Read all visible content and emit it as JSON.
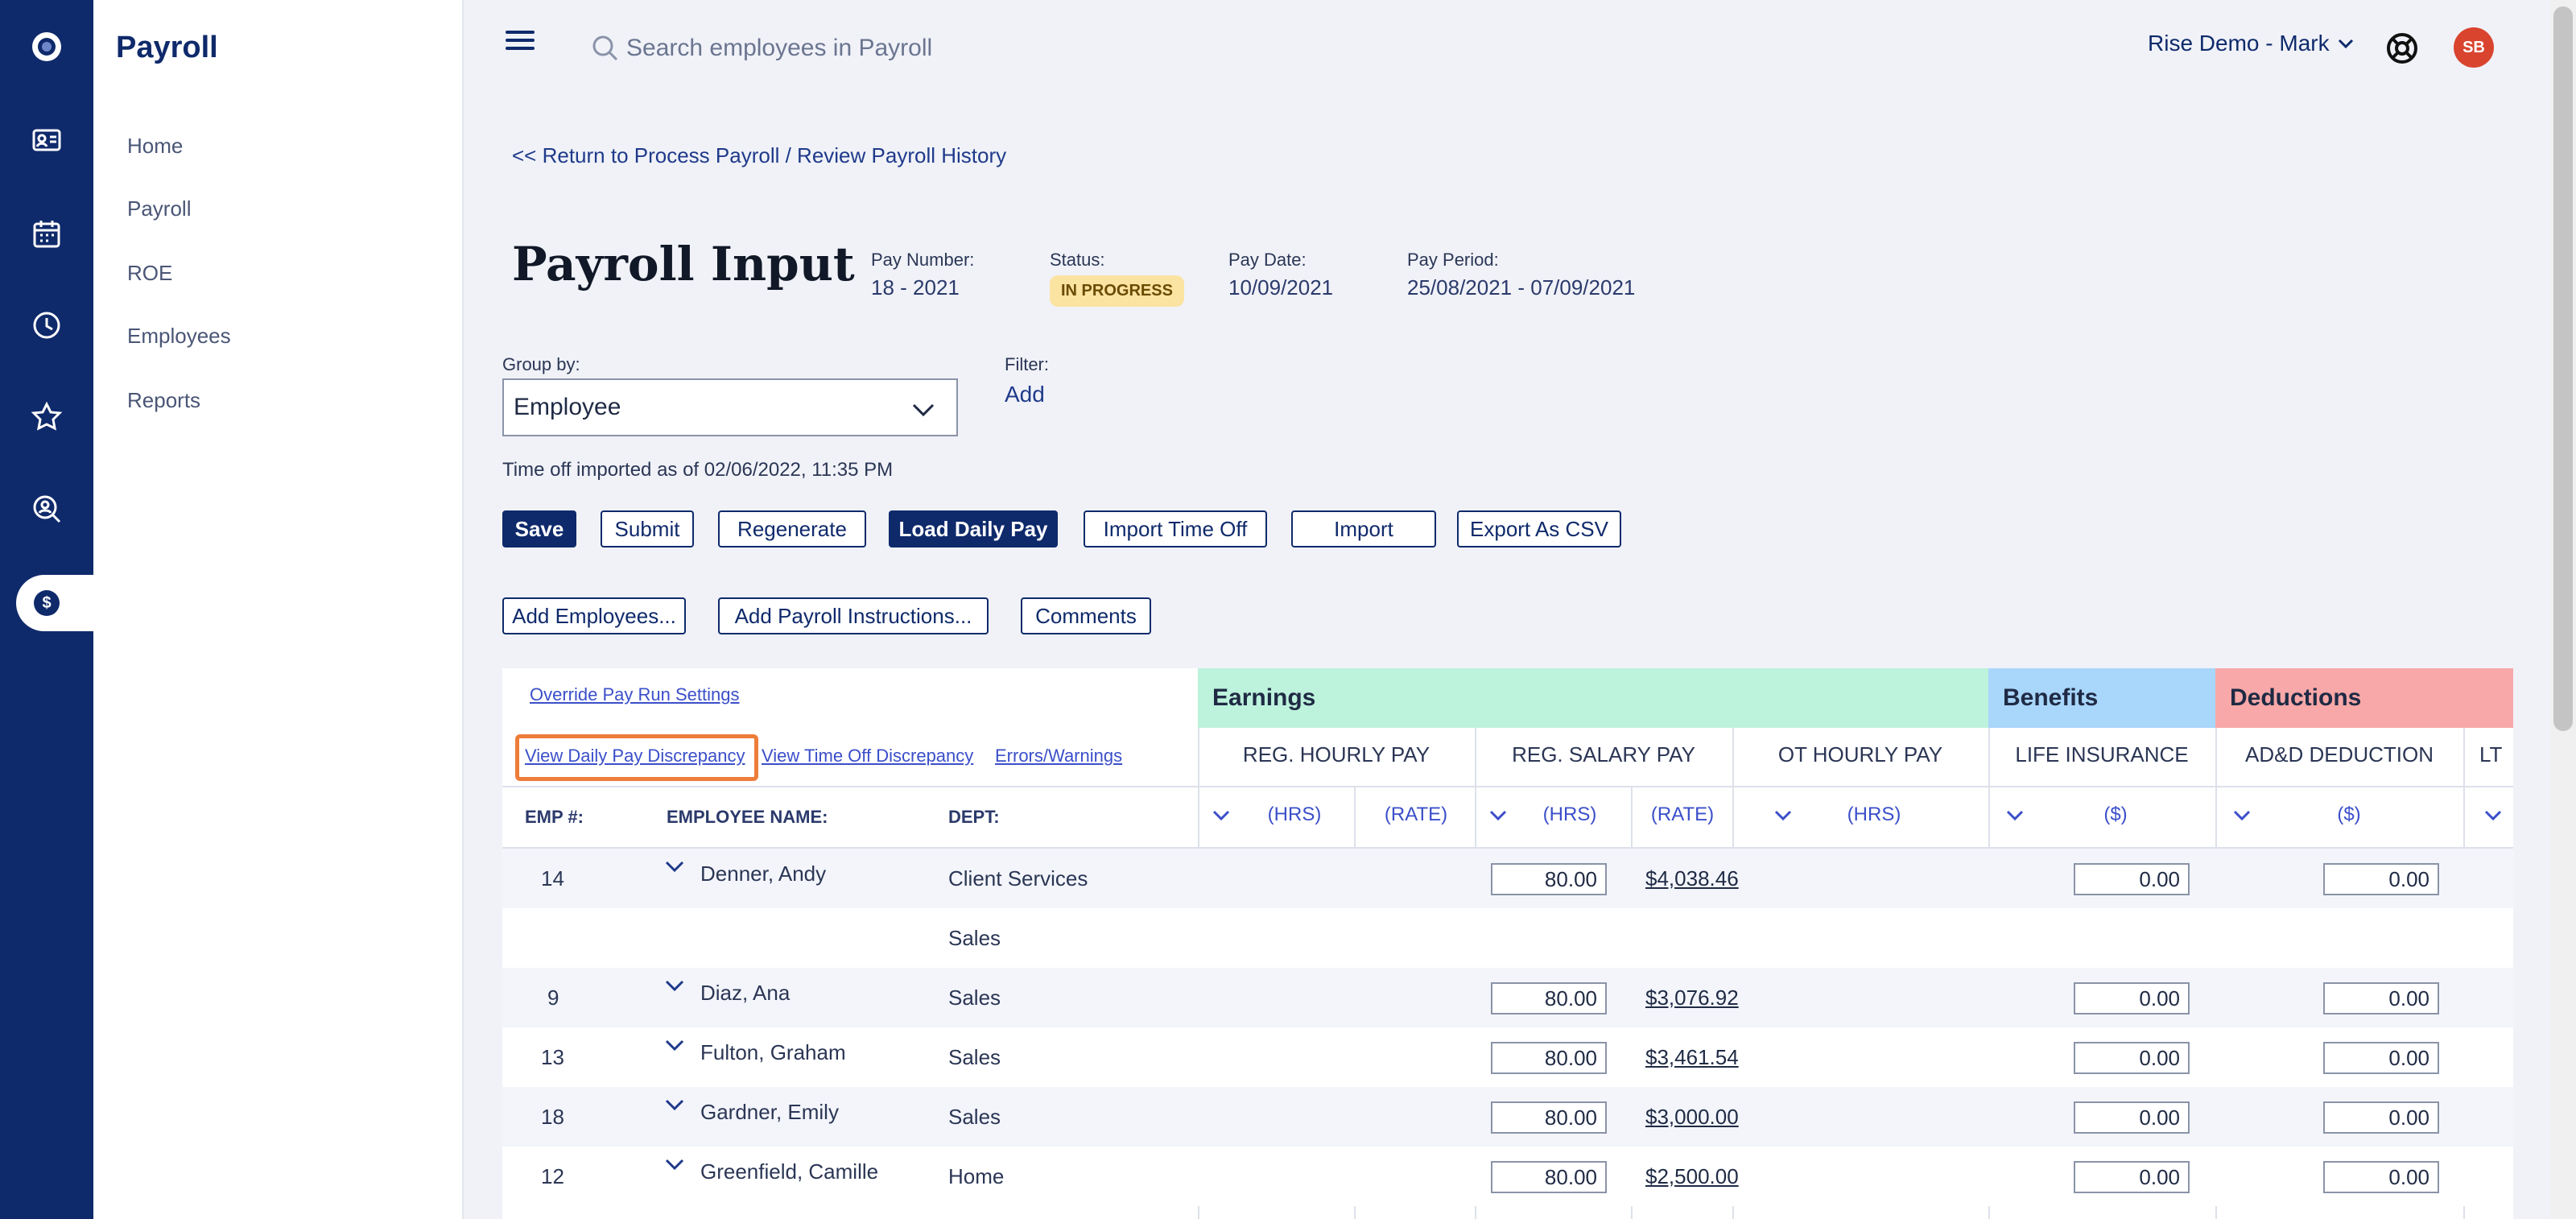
{
  "sidenav": {
    "title": "Payroll",
    "items": [
      {
        "label": "Home"
      },
      {
        "label": "Payroll"
      },
      {
        "label": "ROE"
      },
      {
        "label": "Employees"
      },
      {
        "label": "Reports"
      }
    ]
  },
  "rail": {
    "icons": [
      "logo-icon",
      "id-card-icon",
      "calendar-icon",
      "clock-icon",
      "star-icon",
      "person-search-icon",
      "dollar-icon"
    ],
    "active_symbol": "$"
  },
  "topbar": {
    "search_placeholder": "Search employees in Payroll",
    "account_label": "Rise Demo - Mark",
    "avatar_initials": "SB"
  },
  "page": {
    "back_link": "<< Return to Process Payroll / Review Payroll History",
    "title": "Payroll Input",
    "pay_number_label": "Pay Number:",
    "pay_number": "18 - 2021",
    "status_label": "Status:",
    "status": "IN PROGRESS",
    "pay_date_label": "Pay Date:",
    "pay_date": "10/09/2021",
    "pay_period_label": "Pay Period:",
    "pay_period": "25/08/2021 - 07/09/2021",
    "group_by_label": "Group by:",
    "group_by_value": "Employee",
    "filter_label": "Filter:",
    "filter_add": "Add",
    "timeoff_text": "Time off imported as of 02/06/2022, 11:35 PM"
  },
  "toolbar": {
    "save": "Save",
    "submit": "Submit",
    "regenerate": "Regenerate",
    "load_daily_pay": "Load Daily Pay",
    "import_time_off": "Import Time Off",
    "import": "Import",
    "export_csv": "Export As CSV",
    "add_employees": "Add Employees...",
    "add_payroll_instructions": "Add Payroll Instructions...",
    "comments": "Comments"
  },
  "table": {
    "links": {
      "override": "Override Pay Run Settings",
      "daily_pay_discrepancy": "View Daily Pay Discrepancy",
      "time_off_discrepancy": "View Time Off Discrepancy",
      "errors_warnings": "Errors/Warnings"
    },
    "columns": {
      "emp_no": "EMP #:",
      "employee_name": "EMPLOYEE NAME:",
      "dept": "DEPT:"
    },
    "bands": {
      "earnings": "Earnings",
      "benefits": "Benefits",
      "deductions": "Deductions"
    },
    "sub_headers": {
      "reg_hourly": "REG. HOURLY PAY",
      "reg_salary": "REG. SALARY PAY",
      "ot_hourly": "OT HOURLY PAY",
      "life_insurance": "LIFE INSURANCE",
      "add_deduction": "AD&D DEDUCTION",
      "lt": "LT"
    },
    "units": {
      "hrs": "(HRS)",
      "rate": "(RATE)",
      "dollars": "($)"
    },
    "colors": {
      "earnings": "#bdf2dc",
      "benefits": "#a9d6fb",
      "deductions": "#f8a8a8"
    },
    "rows": [
      {
        "emp": "14",
        "name": "Denner, Andy",
        "dept": "Client Services",
        "hrs": "80.00",
        "salary": "$4,038.46",
        "life": "0.00",
        "add": "0.00"
      },
      {
        "emp": "",
        "name": "",
        "dept": "Sales",
        "hrs": "",
        "salary": "",
        "life": "",
        "add": ""
      },
      {
        "emp": "9",
        "name": "Diaz, Ana",
        "dept": "Sales",
        "hrs": "80.00",
        "salary": "$3,076.92",
        "life": "0.00",
        "add": "0.00"
      },
      {
        "emp": "13",
        "name": "Fulton, Graham",
        "dept": "Sales",
        "hrs": "80.00",
        "salary": "$3,461.54",
        "life": "0.00",
        "add": "0.00"
      },
      {
        "emp": "18",
        "name": "Gardner, Emily",
        "dept": "Sales",
        "hrs": "80.00",
        "salary": "$3,000.00",
        "life": "0.00",
        "add": "0.00"
      },
      {
        "emp": "12",
        "name": "Greenfield, Camille",
        "dept": "Home",
        "hrs": "80.00",
        "salary": "$2,500.00",
        "life": "0.00",
        "add": "0.00"
      }
    ]
  }
}
